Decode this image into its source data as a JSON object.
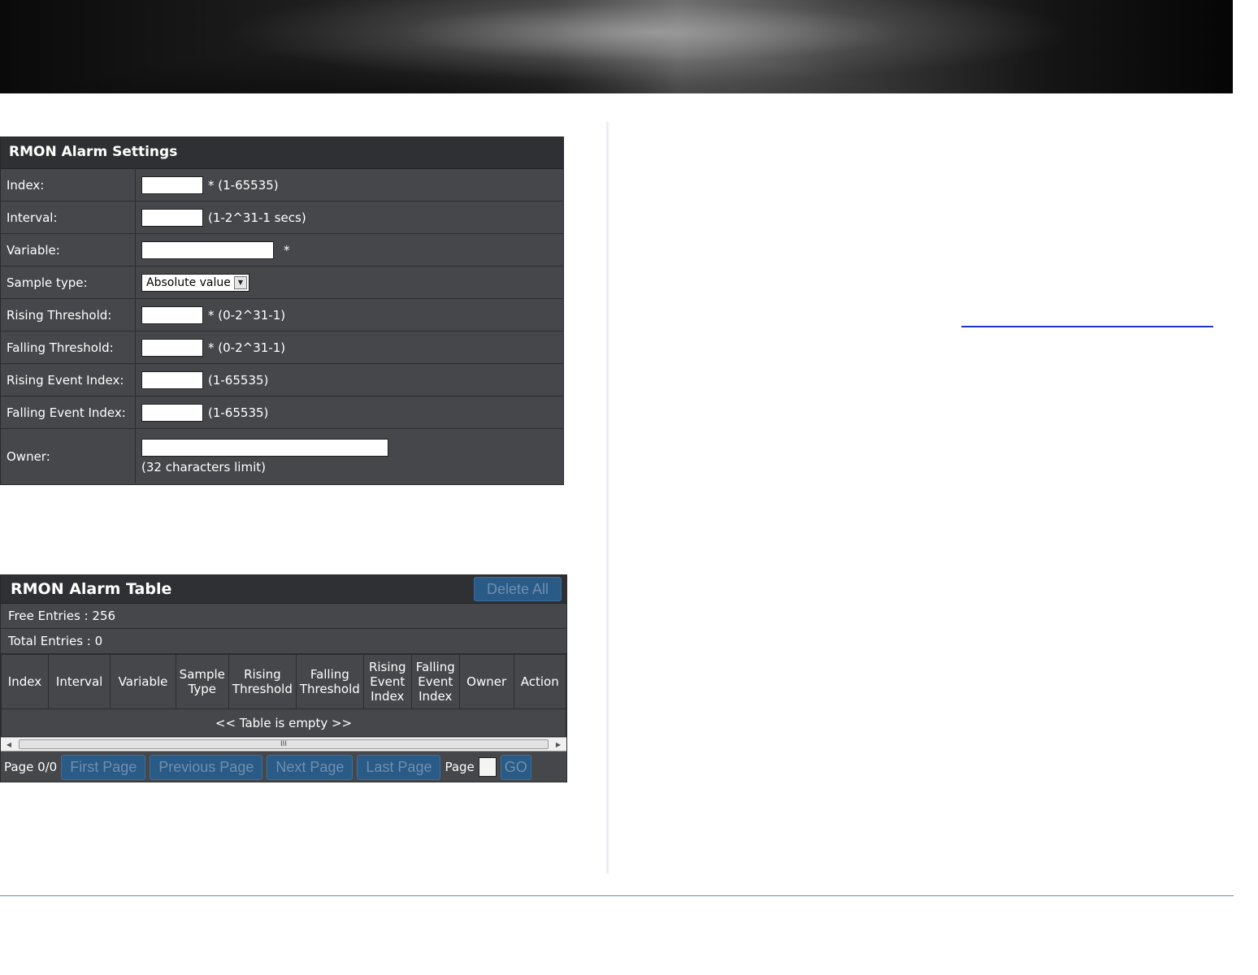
{
  "colors": {
    "panel_bg": "#46474b",
    "panel_title_bg": "#2f3033",
    "button_bg": "#2a5a86",
    "link_line": "#2233cc",
    "footer_rule": "#5b8ec9"
  },
  "settings": {
    "title": "RMON Alarm Settings",
    "index_label": "Index:",
    "index_value": "",
    "index_note": "* (1-65535)",
    "interval_label": "Interval:",
    "interval_value": "",
    "interval_note": "(1-2^31-1 secs)",
    "variable_label": "Variable:",
    "variable_value": "",
    "variable_note": "*",
    "sample_type_label": "Sample type:",
    "sample_type_value": "Absolute value",
    "rising_threshold_label": "Rising Threshold:",
    "rising_threshold_value": "",
    "rising_threshold_note": "* (0-2^31-1)",
    "falling_threshold_label": "Falling Threshold:",
    "falling_threshold_value": "",
    "falling_threshold_note": "* (0-2^31-1)",
    "rising_event_label": "Rising Event Index:",
    "rising_event_value": "",
    "rising_event_note": "(1-65535)",
    "falling_event_label": "Falling Event Index:",
    "falling_event_value": "",
    "falling_event_note": "(1-65535)",
    "owner_label": "Owner:",
    "owner_value": "",
    "owner_note": "(32 characters limit)"
  },
  "alarm_table": {
    "title": "RMON Alarm Table",
    "delete_all": "Delete All",
    "free_entries": "Free Entries : 256",
    "total_entries": "Total Entries : 0",
    "columns": [
      "Index",
      "Interval",
      "Variable",
      "Sample Type",
      "Rising Threshold",
      "Falling Threshold",
      "Rising Event Index",
      "Falling Event Index",
      "Owner",
      "Action"
    ],
    "empty_message": "<< Table is empty >>",
    "scroll_grip": "III"
  },
  "pager": {
    "page_status": "Page 0/0",
    "first": "First Page",
    "previous": "Previous Page",
    "next": "Next Page",
    "last": "Last Page",
    "page_label": "Page",
    "page_value": "",
    "go": "GO"
  }
}
